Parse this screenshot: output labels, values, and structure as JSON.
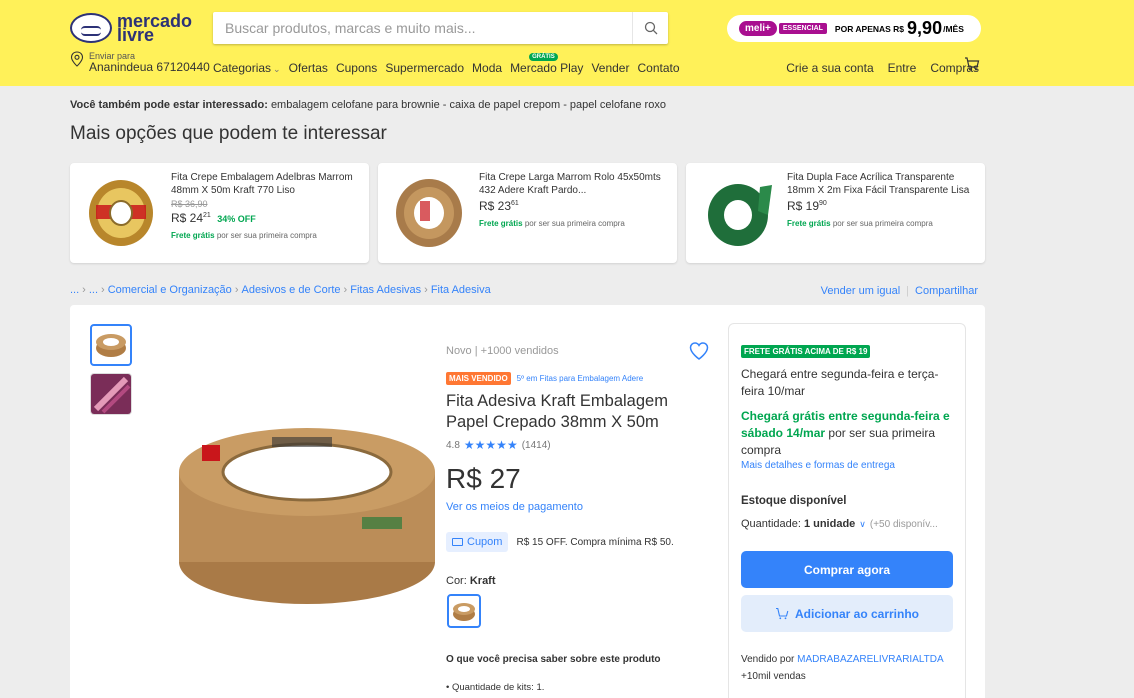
{
  "header": {
    "logo_text_1": "mercado",
    "logo_text_2": "livre",
    "search_placeholder": "Buscar produtos, marcas e muito mais...",
    "promo": {
      "meli": "meli+",
      "essencial": "ESSENCIAL",
      "label": "POR APENAS R$",
      "price": "9,90",
      "suffix": "/MÊS"
    },
    "location_label": "Enviar para",
    "location_value": "Ananindeua 67120440",
    "nav": [
      "Categorias",
      "Ofertas",
      "Cupons",
      "Supermercado",
      "Moda",
      "Mercado Play",
      "Vender",
      "Contato"
    ],
    "nav_badge": "GRÁTIS",
    "user_nav": [
      "Crie a sua conta",
      "Entre",
      "Compras"
    ]
  },
  "suggestions": {
    "label": "Você também pode estar interessado:",
    "items": "embalagem celofane para brownie - caixa de papel crepom - papel celofane roxo"
  },
  "more_title": "Mais opções que podem te interessar",
  "recommendations": [
    {
      "title": "Fita Crepe Embalagem Adelbras Marrom 48mm X 50m Kraft 770 Liso",
      "old_price": "R$ 36,90",
      "price": "R$ 24",
      "cents": "21",
      "discount": "34% OFF",
      "ship_bold": "Frete grátis",
      "ship_rest": "por ser sua primeira compra"
    },
    {
      "title": "Fita Crepe Larga Marrom Rolo 45x50mts 432 Adere Kraft Pardo...",
      "old_price": "",
      "price": "R$ 23",
      "cents": "61",
      "discount": "",
      "ship_bold": "Frete grátis",
      "ship_rest": "por ser sua primeira compra"
    },
    {
      "title": "Fita Dupla Face Acrílica Transparente 18mm X 2m Fixa Fácil Transparente Lisa",
      "old_price": "",
      "price": "R$ 19",
      "cents": "90",
      "discount": "",
      "ship_bold": "Frete grátis",
      "ship_rest": "por ser sua primeira compra"
    }
  ],
  "breadcrumb": [
    "...",
    "...",
    "Comercial e Organização",
    "Adesivos e de Corte",
    "Fitas Adesivas",
    "Fita Adesiva"
  ],
  "breadcrumb_actions": [
    "Vender um igual",
    "Compartilhar"
  ],
  "product": {
    "meta": "Novo  |  +1000 vendidos",
    "best_seller": "MAIS VENDIDO",
    "best_rank": "5º em Fitas para Embalagem Adere",
    "title": "Fita Adesiva Kraft Embalagem Papel Crepado 38mm X 50m",
    "rating": "4.8",
    "stars": "★★★★★",
    "reviews": "(1414)",
    "price": "R$ 27",
    "pay_link": "Ver os meios de pagamento",
    "coupon_tag": "Cupom",
    "coupon_text": "R$ 15 OFF. Compra mínima R$ 50.",
    "color_label": "Cor:",
    "color_value": "Kraft",
    "need_title": "O que você precisa saber sobre este produto",
    "bullet": "• Quantidade de kits: 1."
  },
  "buybox": {
    "free_badge": "FRETE GRÁTIS ACIMA DE R$ 19",
    "arrive": "Chegará entre segunda-feira e terça-feira 10/mar",
    "arrive_green": "Chegará grátis entre segunda-feira e sábado 14/mar",
    "arrive_green_rest": "por ser sua primeira compra",
    "delivery_link": "Mais detalhes e formas de entrega",
    "stock": "Estoque disponível",
    "qty_label": "Quantidade:",
    "qty_value": "1 unidade",
    "qty_avail": "(+50 disponív...",
    "buy_now": "Comprar agora",
    "add_cart": "Adicionar ao carrinho",
    "seller_label": "Vendido por",
    "seller_name": "MADRABAZARELIVRARIALTDA",
    "sales": "+10mil vendas"
  },
  "colors": {
    "header": "#fff159",
    "accent": "#3483fa",
    "green": "#00a650",
    "orange": "#ff7733"
  }
}
